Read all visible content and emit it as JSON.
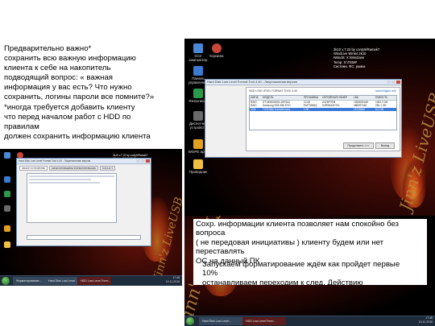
{
  "left_text": {
    "lines": [
      "Предварительно важно*",
      "сохранить всю важную информацию",
      "клиента к себе на накопитель",
      "подводящий вопрос: « важная",
      "информация у вас есть? Что нужно",
      "сохранить, логины пароли все помните?»",
      "*иногда требуется добавить клиенту",
      "что перед началом работ с HDD по",
      "правилам",
      "должен сохранить информацию клиента"
    ]
  },
  "bottom_text": {
    "lines": [
      "Сохр. информации  клиента позволяет нам спокойно без",
      "вопроса",
      "( не передовая инициативы ) клиенту будем или нет",
      "переставлять",
      "ОС на данный ПК"
    ],
    "overlap_lines": [
      "Запускаем форматирование ждём как пройдет первые",
      "10%",
      "останавливаем переходим к след. Действию"
    ]
  },
  "screenshot_top": {
    "desktop_icons": [
      {
        "label": "Этот компьютер",
        "color": "#4a88d8"
      },
      {
        "label": "Корзина",
        "color": "#9aa6b4"
      },
      {
        "label": "Панель управления",
        "color": "#3a7ad0"
      },
      {
        "label": "Restoration",
        "color": "#2a9a4a"
      },
      {
        "label": "Диспетчер устройств",
        "color": "#6a6a6a"
      },
      {
        "label": "WinPE apps",
        "color": "#e0a020"
      },
      {
        "label": "Проводник",
        "color": "#f0c040"
      }
    ],
    "overlay_lines": [
      "2k10 v.7.22  by conty9/Ramak7",
      "WindLive  Win64 2k10",
      "IWindS:  X:\\Windows",
      "Temp:  X:\\TEMP",
      "Системн. ФС: рамка"
    ],
    "window_title": "Hard Disk Low Level Format Tool 4.40 - Лицензионная версия",
    "window_inner_title": "HDD LOW LEVEL FORMAT TOOL 4.40",
    "site": "www.hddguru.com",
    "columns": [
      "ШИНА",
      "МОДЕЛЬ",
      "ПРОШИВКА",
      "СЕРИЙНЫЙ НОМЕР",
      "LBA",
      "ЕМКОСТЬ"
    ],
    "rows": [
      [
        "RAID",
        "ST1000DM003-1ER162",
        "CC45",
        "Z4Y8P7EM",
        "1953525168",
        "1000.2 GB"
      ],
      [
        "RAID",
        "Samsung SSD 850 EVO",
        "EMT02B6Q",
        "S2R5NX0H701",
        "488397168",
        "250.1 GB"
      ],
      [
        "USB",
        "TOSHIBA TransMemory",
        "1.00",
        "",
        "15728640",
        "8.0 GB"
      ]
    ],
    "buttons": [
      "Продолжить >>>",
      "Выход"
    ],
    "brand_script": "Jinn'z LiveUSB"
  },
  "screenshot_small": {
    "window_title": "Hard Disk Low Level Format Tool 4.40 - Лицензионная версия",
    "tabs": [
      "ОБЗОР УСТРОЙСТВА",
      "НИЗКОУРОВНЕВОЕ ФОРМАТИРОВАНИЕ",
      "S.M.A.R.T."
    ],
    "overlay_lines": [
      "2k10 v.7.22  by conty9/Ramak7",
      "WinLive Win64 2k10"
    ],
    "taskbar_items": [
      "Форматирование...",
      "Hard Disk Low Level...",
      "HDD Low Level Form..."
    ],
    "clock": [
      "17:48",
      "19.11.2016"
    ],
    "brand_script": "Jinn'z LiveUSB"
  },
  "screenshot_right": {
    "brand_script": "Jinn'z LiveUSB",
    "taskbar_items": [
      "Hard Disk Low Level...",
      "HDD Low Level Form..."
    ],
    "clock": [
      "17:48",
      "19.11.2016"
    ]
  }
}
